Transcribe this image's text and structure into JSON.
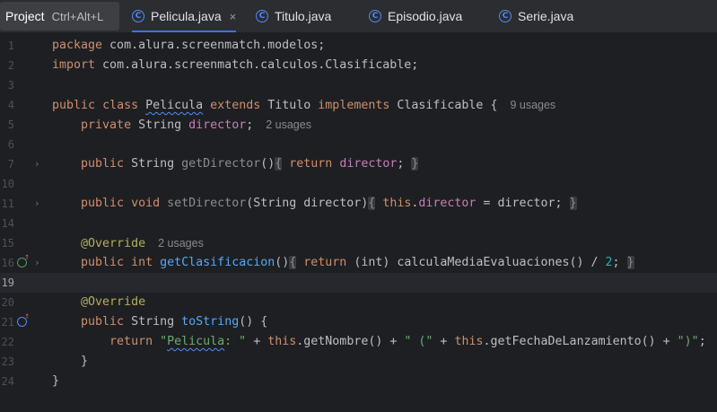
{
  "topbar": {
    "project_label": "Project",
    "project_shortcut": "Ctrl+Alt+L",
    "tabs": [
      {
        "icon": "class-c-icon",
        "label": "Pelicula.java",
        "active": true
      },
      {
        "icon": "class-c-icon",
        "label": "Titulo.java"
      },
      {
        "icon": "class-c-icon",
        "label": "Episodio.java"
      },
      {
        "icon": "class-c-icon",
        "label": "Serie.java"
      }
    ],
    "close_glyph": "×"
  },
  "editor": {
    "current_line": "19",
    "line_numbers": [
      "1",
      "2",
      "3",
      "4",
      "5",
      "6",
      "7",
      "10",
      "11",
      "14",
      "15",
      "16",
      "19",
      "20",
      "21",
      "22",
      "23",
      "24"
    ],
    "hints": {
      "class_usages": "9 usages",
      "director_usages": "2 usages",
      "override_usages": "2 usages"
    },
    "tokens": {
      "pkg": "package",
      "pkg_name": " com.alura.screenmatch.modelos;",
      "imp": "import",
      "imp_name": " com.alura.screenmatch.calculos.Clasificable;",
      "public": "public",
      "class": "class",
      "class_name": "Pelicula",
      "extends": "extends",
      "super": "Titulo",
      "implements": "implements",
      "iface": "Clasificable {",
      "private": "private",
      "type_string": "String",
      "director": "director",
      "semi": ";",
      "get_director": "getDirector",
      "parens": "()",
      "return": "return",
      "void": "void",
      "set_director": "setDirector",
      "set_params": "(String director)",
      "this": "this",
      "assign_rhs": " = director;",
      "override": "@Override",
      "int": "int",
      "get_clas": "getClasificacion",
      "ret_tail": " (int) calculaMediaEvaluaciones() / ",
      "two": "2",
      "to_string": "toString",
      "to_string_tail": "() {",
      "str_pelicula_q": "\"",
      "str_pelicula_word": "Pelicula",
      "str_pelicula_rest": ": \"",
      "plus": " + ",
      "get_nombre": "getNombre",
      "str_paren": "\" (\"",
      "get_fecha": "getFechaDeLanzamiento",
      "str_close": "\")\"",
      "close_brace": "}",
      "open_brace": "{",
      "dot": "."
    }
  }
}
